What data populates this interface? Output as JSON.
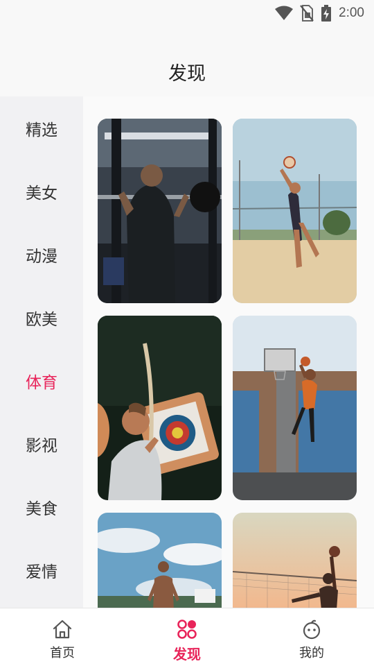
{
  "status_bar": {
    "time": "2:00",
    "icons": [
      "wifi-icon",
      "no-sim-icon",
      "battery-charging-icon"
    ]
  },
  "page": {
    "title": "发现"
  },
  "sidebar": {
    "items": [
      {
        "label": "精选",
        "active": false
      },
      {
        "label": "美女",
        "active": false
      },
      {
        "label": "动漫",
        "active": false
      },
      {
        "label": "欧美",
        "active": false
      },
      {
        "label": "体育",
        "active": true
      },
      {
        "label": "影视",
        "active": false
      },
      {
        "label": "美食",
        "active": false
      },
      {
        "label": "爱情",
        "active": false
      }
    ]
  },
  "grid": {
    "cards": [
      {
        "subject": "weightlifting-photo"
      },
      {
        "subject": "volleyball-photo"
      },
      {
        "subject": "archery-photo"
      },
      {
        "subject": "basketball-photo"
      },
      {
        "subject": "shirtless-athlete-photo"
      },
      {
        "subject": "beach-volleyball-sunset-photo"
      }
    ]
  },
  "bottom_nav": {
    "items": [
      {
        "label": "首页",
        "icon": "home-icon",
        "active": false
      },
      {
        "label": "发现",
        "icon": "discover-icon",
        "active": true
      },
      {
        "label": "我的",
        "icon": "profile-icon",
        "active": false
      }
    ]
  },
  "colors": {
    "accent": "#e8245a",
    "sidebar_bg": "#f1f1f3",
    "page_bg": "#f8f8f8",
    "nav_bg": "#ffffff"
  }
}
